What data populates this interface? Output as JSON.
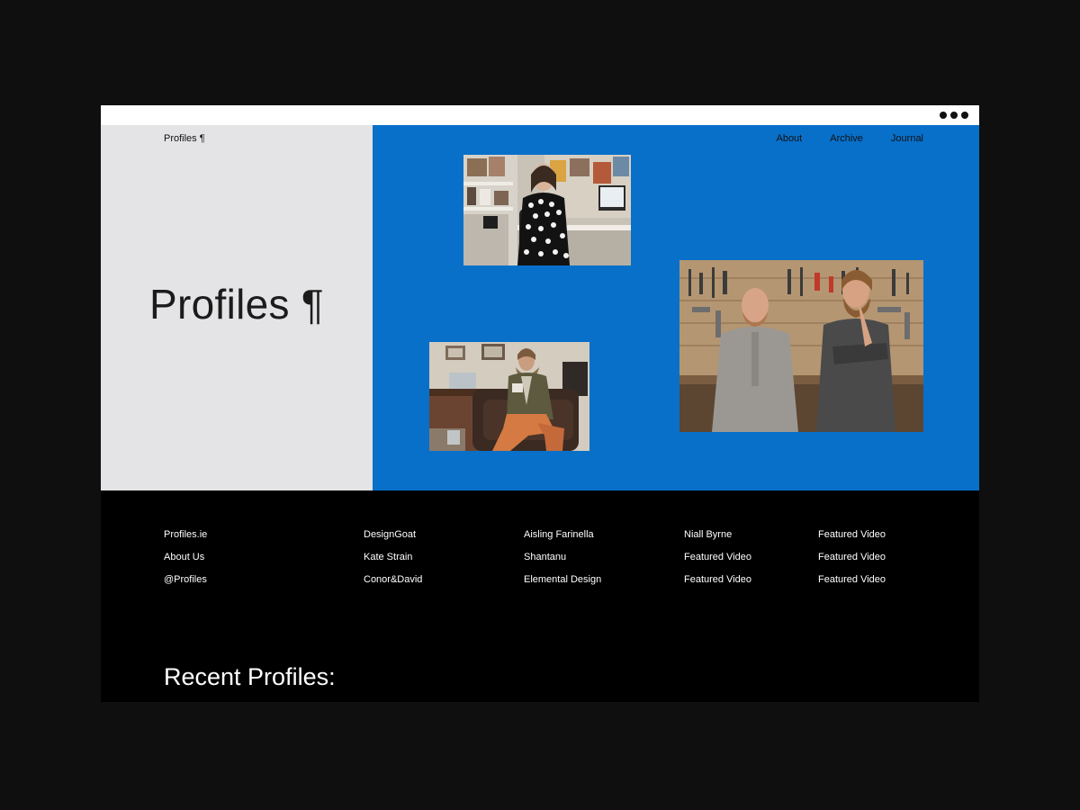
{
  "window": {
    "menu_icon": "more-dots-icon"
  },
  "header": {
    "logo_label": "Profiles ¶",
    "nav": [
      "About",
      "Archive",
      "Journal"
    ]
  },
  "hero": {
    "title": "Profiles ¶"
  },
  "footer": {
    "columns": [
      [
        "Profiles.ie",
        "About Us",
        "@Profiles"
      ],
      [
        "DesignGoat",
        "Kate Strain",
        "Conor&David"
      ],
      [
        "Aisling Farinella",
        "Shantanu",
        "Elemental Design"
      ],
      [
        "Niall Byrne",
        "Featured Video",
        "Featured Video"
      ],
      [
        "Featured Video",
        "Featured Video",
        "Featured Video"
      ]
    ]
  },
  "recent": {
    "heading": "Recent Profiles:"
  },
  "colors": {
    "accent_blue": "#0870c9",
    "panel_grey": "#e4e3e5",
    "background": "#0f0f0f"
  }
}
